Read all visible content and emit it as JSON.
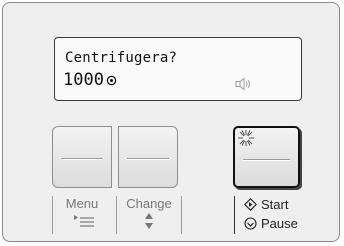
{
  "display": {
    "line1": "Centrifugera?",
    "spin_value": "1000",
    "spin_icon": "spin-symbol-icon",
    "sound_icon": "speaker-icon"
  },
  "buttons": {
    "menu_label": "Menu",
    "change_label": "Change",
    "start_label": "Start",
    "pause_label": "Pause",
    "start_icon": "diamond-arrow-icon",
    "pause_icon": "circle-check-icon",
    "led_icon": "blinking-led-icon",
    "menu_icon": "menu-arrow-icon",
    "change_icon": "up-down-arrows-icon"
  },
  "colors": {
    "panel_bg": "#efefef",
    "text_dark": "#111111",
    "label_gray": "#777777"
  }
}
